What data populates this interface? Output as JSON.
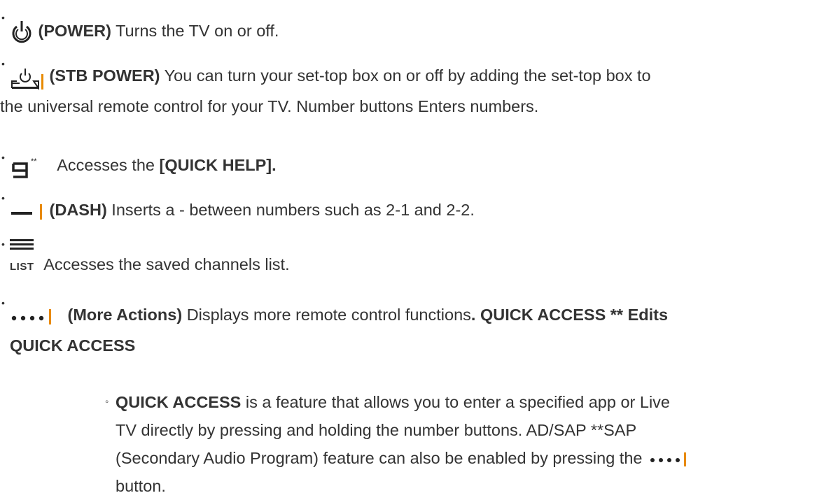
{
  "items": [
    {
      "icon": "power-icon",
      "label": "(POWER)",
      "text": " Turns the TV on or off."
    },
    {
      "icon": "stb-power-icon",
      "label": "(STB POWER)",
      "text": " You can turn your set-top box on or off by adding the set-top box to",
      "text2": "the universal remote control for your TV. Number buttons Enters numbers."
    },
    {
      "icon": "nine-quick-help-icon",
      "icon_superscript": "**",
      "text": " Accesses the ",
      "bold_tail": "[QUICK HELP]."
    },
    {
      "icon": "dash-icon",
      "label": "(DASH)",
      "text": " Inserts a - between numbers such as 2-1 and 2-2."
    },
    {
      "icon": "list-icon",
      "icon_caption": "LIST",
      "text": " Accesses the saved channels list."
    },
    {
      "icon": "more-actions-icon",
      "label": "(More Actions)",
      "text": " Displays more remote control functions",
      "bold_tail": ". QUICK ACCESS ** Edits",
      "bold_line2": "QUICK ACCESS"
    }
  ],
  "sub_item": {
    "bold_lead": "QUICK ACCESS",
    "line1": " is a feature that allows you to enter a specified app or Live",
    "line2": "TV directly by pressing and holding the number buttons. AD/SAP **SAP",
    "line3": "(Secondary Audio Program) feature can also be enabled by pressing the",
    "line4": "button."
  }
}
